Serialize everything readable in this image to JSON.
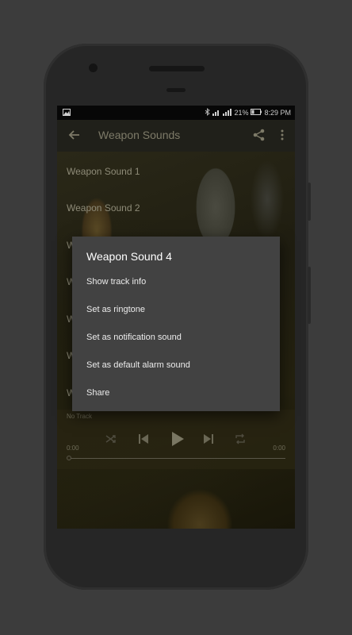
{
  "status_bar": {
    "battery": "21%",
    "time": "8:29 PM"
  },
  "app_bar": {
    "title": "Weapon Sounds"
  },
  "tracks": [
    "Weapon Sound 1",
    "Weapon Sound 2",
    "W",
    "W",
    "W",
    "W",
    "W"
  ],
  "player": {
    "no_track_label": "No Track",
    "elapsed": "0:00",
    "duration": "0:00"
  },
  "dialog": {
    "title": "Weapon Sound 4",
    "options": [
      "Show track info",
      "Set as ringtone",
      "Set as notification sound",
      "Set as default alarm sound",
      "Share"
    ]
  },
  "colors": {
    "dialog_bg": "#424242",
    "app_bar_bg": "#20201a"
  }
}
